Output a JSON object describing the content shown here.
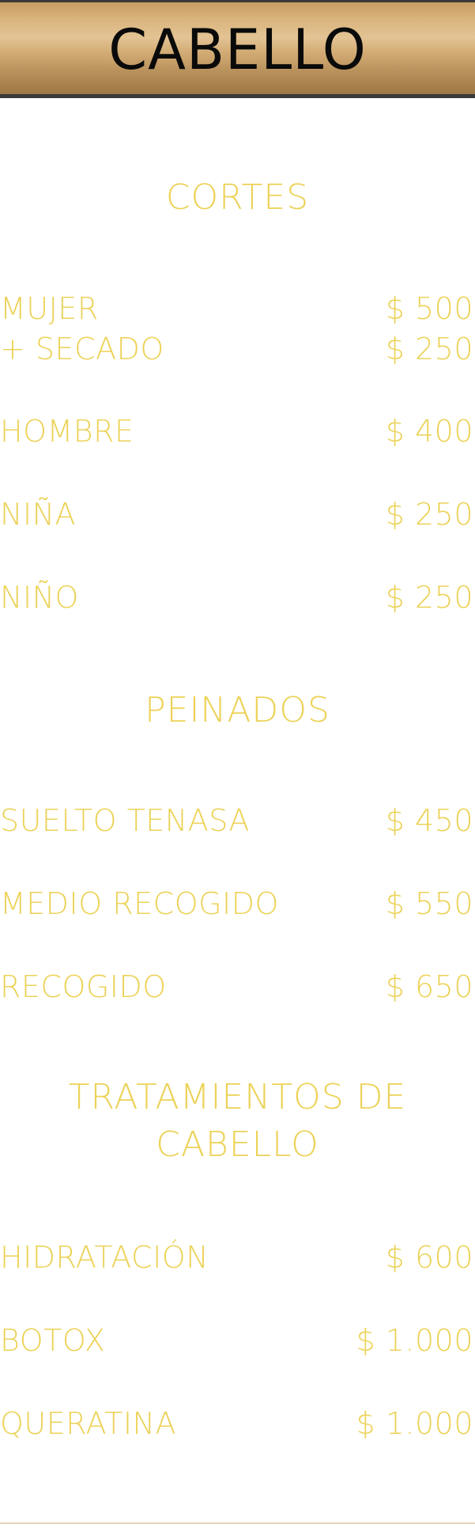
{
  "header": {
    "title": "CABELLO"
  },
  "sections": {
    "cortes": {
      "title": "CORTES",
      "items": [
        {
          "name": "MUJER",
          "price": "$ 500"
        },
        {
          "name": "+ SECADO",
          "price": "$ 250"
        },
        {
          "name": "HOMBRE",
          "price": "$ 400"
        },
        {
          "name": "NIÑA",
          "price": "$ 250"
        },
        {
          "name": "NIÑO",
          "price": "$ 250"
        }
      ]
    },
    "peinados": {
      "title": "PEINADOS",
      "items": [
        {
          "name": "SUELTO TENASA",
          "price": "$ 450"
        },
        {
          "name": "MEDIO RECOGIDO",
          "price": "$ 550"
        },
        {
          "name": "RECOGIDO",
          "price": "$ 650"
        }
      ]
    },
    "tratamientos": {
      "title_line1": "TRATAMIENTOS DE",
      "title_line2": "CABELLO",
      "items": [
        {
          "name": "HIDRATACIÓN",
          "price": "$ 600"
        },
        {
          "name": "BOTOX",
          "price": "$ 1.000"
        },
        {
          "name": "QUERATINA",
          "price": "$ 1.000"
        }
      ]
    }
  },
  "colors": {
    "accent_gold_text": "#ecd258",
    "header_gold": "#d2ab74",
    "header_border": "#3a3a3a"
  }
}
